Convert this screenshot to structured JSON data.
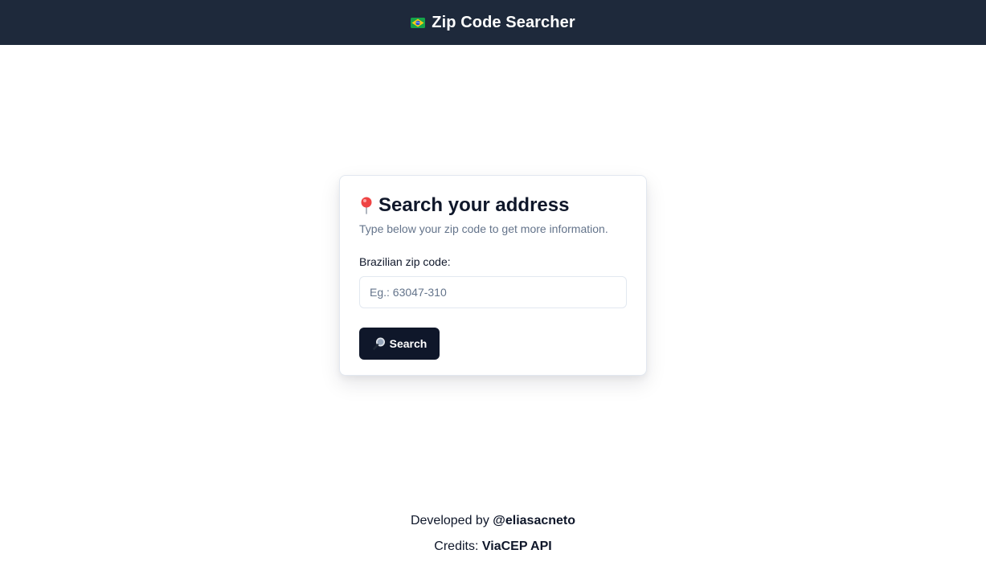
{
  "header": {
    "title": "Zip Code Searcher",
    "icon": "brazil-flag-icon",
    "background_color": "#1e293b"
  },
  "card": {
    "title": "Search your address",
    "title_icon": "pin-icon",
    "subtitle": "Type below your zip code to get more information.",
    "field_label": "Brazilian zip code:",
    "input_value": "",
    "input_placeholder": "Eg.: 63047-310",
    "search_button_label": "Search",
    "search_button_icon": "magnifier-icon",
    "button_color": "#0f172a"
  },
  "footer": {
    "developed_prefix": "Developed by ",
    "developer_handle": "@eliasacneto",
    "credits_prefix": "Credits: ",
    "credits_name": "ViaCEP API"
  }
}
